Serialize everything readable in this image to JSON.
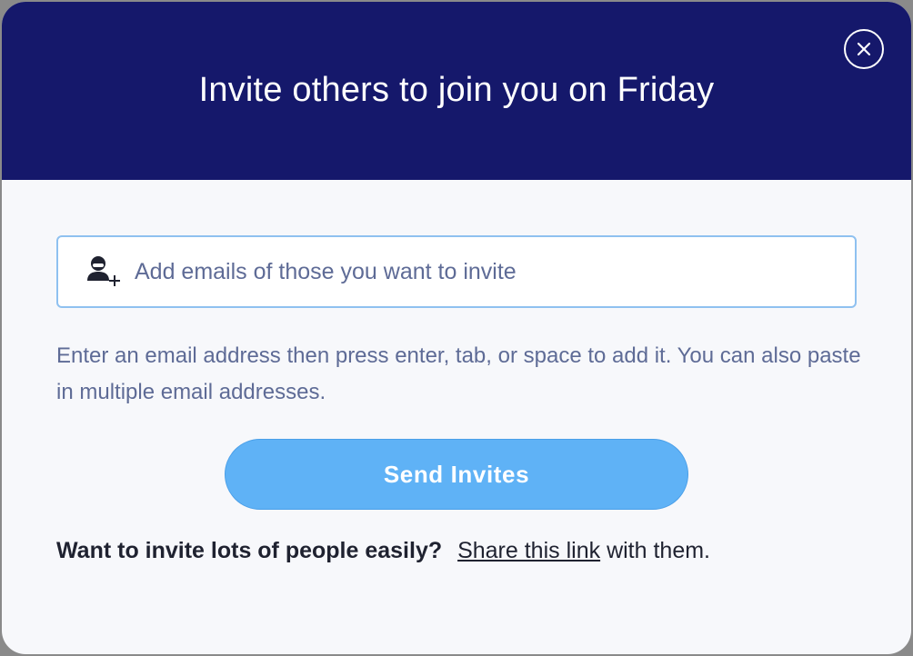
{
  "modal": {
    "title": "Invite others to join you on Friday",
    "close_icon": "close-icon"
  },
  "invite": {
    "input_icon": "user-add-icon",
    "placeholder": "Add emails of those you want to invite",
    "value": "",
    "helper_text": "Enter an email address then press enter, tab, or space to add it. You can also paste in multiple email addresses."
  },
  "send_button": {
    "label": "Send Invites"
  },
  "footer": {
    "question": "Want to invite lots of people easily?",
    "link_label": "Share this link",
    "suffix": "with them."
  },
  "colors": {
    "header_bg": "#15186b",
    "accent_button": "#5fb2f6",
    "input_border": "#8fc1f0",
    "helper_text": "#5e6b96"
  }
}
